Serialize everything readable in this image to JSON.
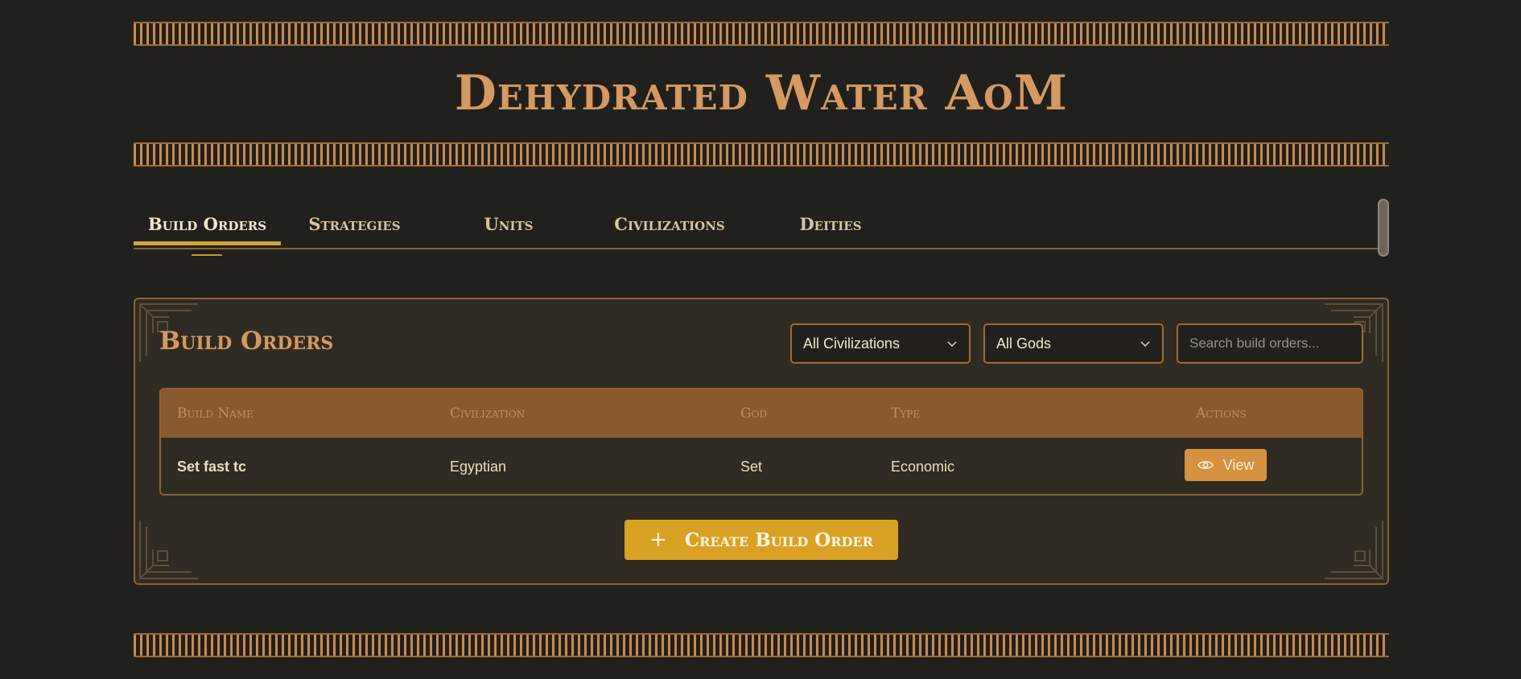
{
  "site": {
    "title": "Dehydrated Water AoM"
  },
  "tabs": [
    {
      "label": "Build Orders",
      "active": true
    },
    {
      "label": "Strategies",
      "active": false
    },
    {
      "label": "Units",
      "active": false
    },
    {
      "label": "Civilizations",
      "active": false
    },
    {
      "label": "Deities",
      "active": false
    }
  ],
  "panel": {
    "title": "Build Orders",
    "filters": {
      "civilization": "All Civilizations",
      "god": "All Gods",
      "search_placeholder": "Search build orders..."
    },
    "table": {
      "headers": [
        "Build Name",
        "Civilization",
        "God",
        "Type",
        "Actions"
      ],
      "rows": [
        {
          "name": "Set fast tc",
          "civilization": "Egyptian",
          "god": "Set",
          "type": "Economic",
          "action_label": "View"
        }
      ]
    },
    "create_button": {
      "icon": "+",
      "label": "Create Build Order"
    }
  },
  "colors": {
    "background": "#21201c",
    "accent": "#d49a62",
    "gold": "#d9a224",
    "table_header": "#8a5a2e"
  }
}
